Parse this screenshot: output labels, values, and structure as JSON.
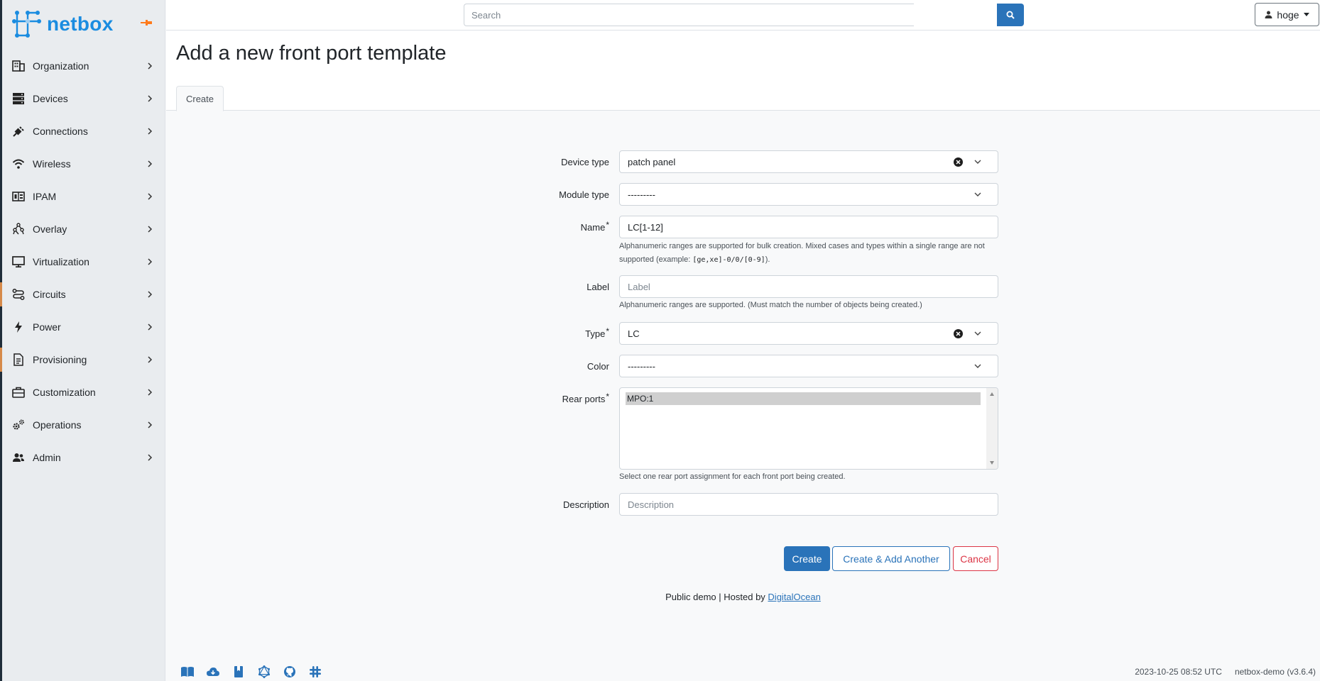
{
  "brand": {
    "name": "netbox",
    "accent": "#1a8ce0"
  },
  "sidebar": {
    "items": [
      {
        "label": "Organization",
        "icon": "building-icon"
      },
      {
        "label": "Devices",
        "icon": "server-icon"
      },
      {
        "label": "Connections",
        "icon": "plug-icon"
      },
      {
        "label": "Wireless",
        "icon": "wifi-icon"
      },
      {
        "label": "IPAM",
        "icon": "ip-icon"
      },
      {
        "label": "Overlay",
        "icon": "graph-icon"
      },
      {
        "label": "Virtualization",
        "icon": "monitor-icon"
      },
      {
        "label": "Circuits",
        "icon": "transit-icon"
      },
      {
        "label": "Power",
        "icon": "lightning-icon"
      },
      {
        "label": "Provisioning",
        "icon": "file-icon"
      },
      {
        "label": "Customization",
        "icon": "toolbox-icon"
      },
      {
        "label": "Operations",
        "icon": "cogs-icon"
      },
      {
        "label": "Admin",
        "icon": "users-icon"
      }
    ]
  },
  "topbar": {
    "search_placeholder": "Search",
    "user": "hoge"
  },
  "page": {
    "title": "Add a new front port template",
    "tab": "Create"
  },
  "form": {
    "device_type": {
      "label": "Device type",
      "value": "patch panel"
    },
    "module_type": {
      "label": "Module type",
      "value": "---------"
    },
    "name": {
      "label": "Name",
      "value": "LC[1-12]",
      "help_a": "Alphanumeric ranges are supported for bulk creation. Mixed cases and types within a single range are not supported (example: ",
      "help_code": "[ge,xe]-0/0/[0-9]",
      "help_b": ")."
    },
    "label": {
      "label": "Label",
      "placeholder": "Label",
      "help": "Alphanumeric ranges are supported. (Must match the number of objects being created.)"
    },
    "type": {
      "label": "Type",
      "value": "LC"
    },
    "color": {
      "label": "Color",
      "value": "---------"
    },
    "rear_ports": {
      "label": "Rear ports",
      "option": "MPO:1",
      "help": "Select one rear port assignment for each front port being created."
    },
    "description": {
      "label": "Description",
      "placeholder": "Description"
    },
    "required_mark": "*"
  },
  "buttons": {
    "create": "Create",
    "create_another": "Create & Add Another",
    "cancel": "Cancel"
  },
  "footer": {
    "note_prefix": "Public demo | Hosted by ",
    "note_link": "DigitalOcean",
    "timestamp": "2023-10-25 08:52 UTC",
    "version": "netbox-demo (v3.6.4)"
  },
  "colors": {
    "primary": "#2a73b9",
    "danger": "#dc3545",
    "sidebar_accent": "#d68a4a"
  }
}
